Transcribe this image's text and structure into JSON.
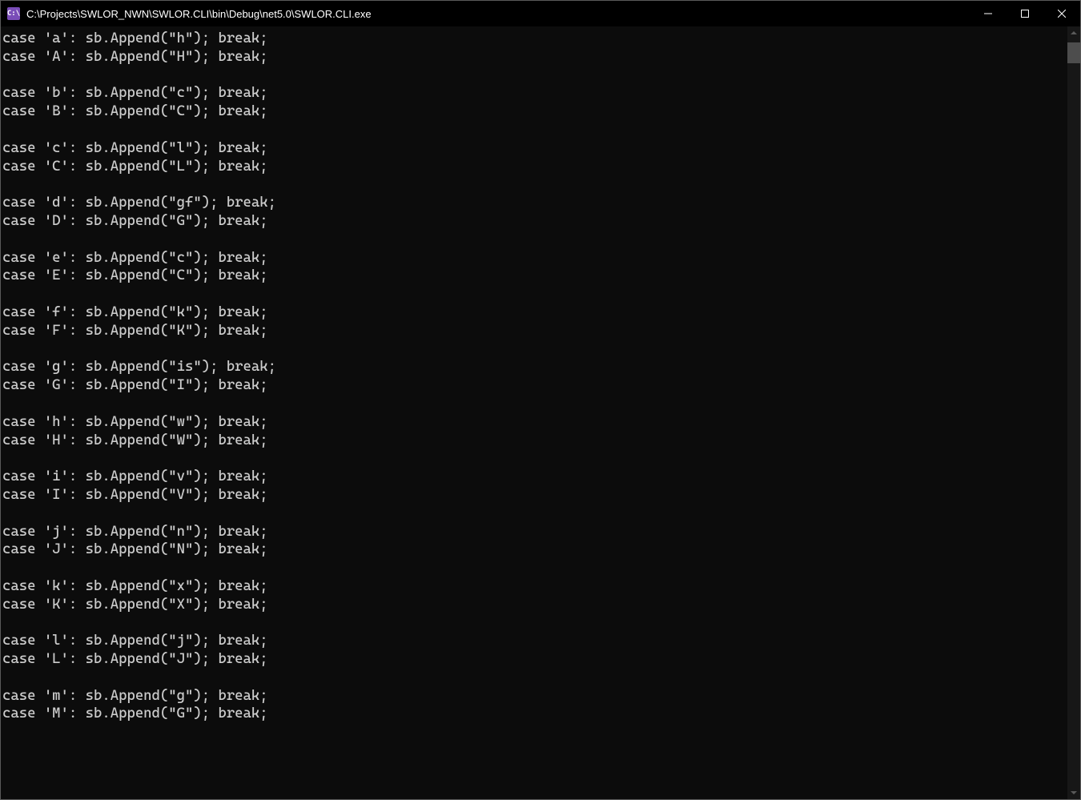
{
  "titlebar": {
    "icon_text": "C:\\",
    "title": "C:\\Projects\\SWLOR_NWN\\SWLOR.CLI\\bin\\Debug\\net5.0\\SWLOR.CLI.exe"
  },
  "console": {
    "lines": [
      "case 'a': sb.Append(\"h\"); break;",
      "case 'A': sb.Append(\"H\"); break;",
      "",
      "case 'b': sb.Append(\"c\"); break;",
      "case 'B': sb.Append(\"C\"); break;",
      "",
      "case 'c': sb.Append(\"l\"); break;",
      "case 'C': sb.Append(\"L\"); break;",
      "",
      "case 'd': sb.Append(\"gf\"); break;",
      "case 'D': sb.Append(\"G\"); break;",
      "",
      "case 'e': sb.Append(\"c\"); break;",
      "case 'E': sb.Append(\"C\"); break;",
      "",
      "case 'f': sb.Append(\"k\"); break;",
      "case 'F': sb.Append(\"K\"); break;",
      "",
      "case 'g': sb.Append(\"is\"); break;",
      "case 'G': sb.Append(\"I\"); break;",
      "",
      "case 'h': sb.Append(\"w\"); break;",
      "case 'H': sb.Append(\"W\"); break;",
      "",
      "case 'i': sb.Append(\"v\"); break;",
      "case 'I': sb.Append(\"V\"); break;",
      "",
      "case 'j': sb.Append(\"n\"); break;",
      "case 'J': sb.Append(\"N\"); break;",
      "",
      "case 'k': sb.Append(\"x\"); break;",
      "case 'K': sb.Append(\"X\"); break;",
      "",
      "case 'l': sb.Append(\"j\"); break;",
      "case 'L': sb.Append(\"J\"); break;",
      "",
      "case 'm': sb.Append(\"g\"); break;",
      "case 'M': sb.Append(\"G\"); break;"
    ]
  }
}
